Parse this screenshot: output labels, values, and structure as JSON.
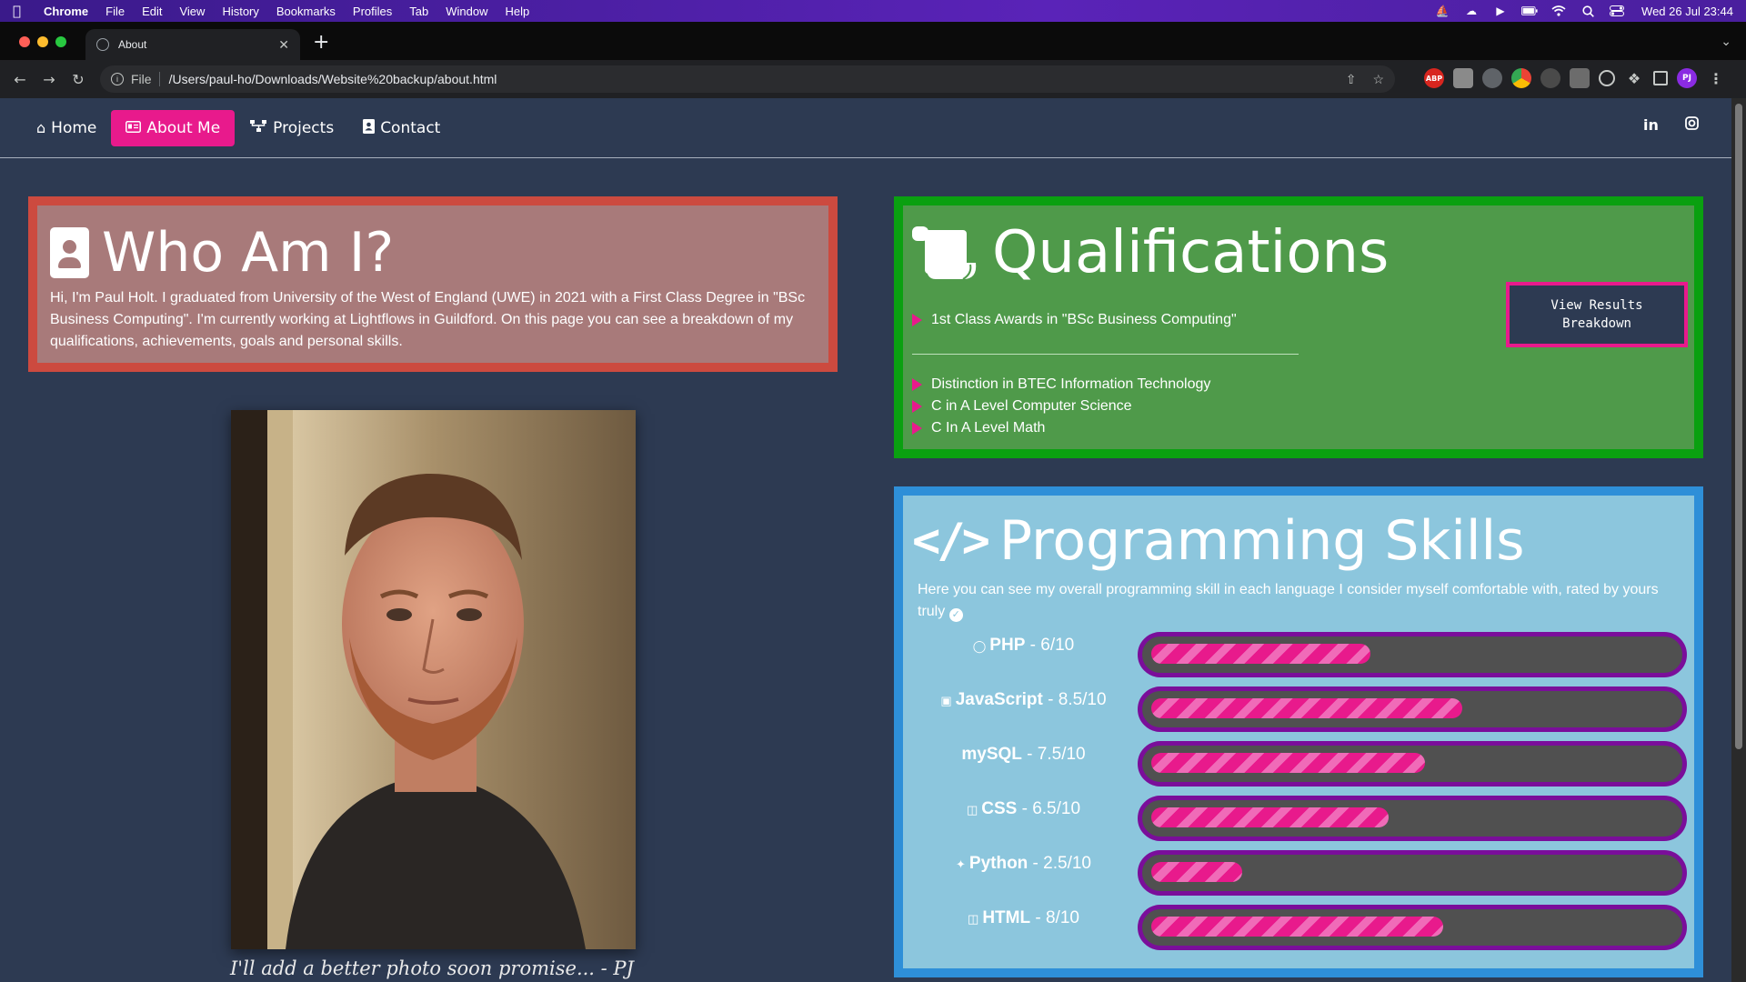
{
  "menubar": {
    "app": "Chrome",
    "items": [
      "File",
      "Edit",
      "View",
      "History",
      "Bookmarks",
      "Profiles",
      "Tab",
      "Window",
      "Help"
    ],
    "clock": "Wed 26 Jul  23:44"
  },
  "browser": {
    "tab_title": "About",
    "url_scheme": "File",
    "url": "/Users/paul-ho/Downloads/Website%20backup/about.html",
    "profile_initials": "PJ",
    "abp_label": "ABP"
  },
  "nav": {
    "items": [
      {
        "label": "Home",
        "icon": "home-icon"
      },
      {
        "label": "About Me",
        "icon": "id-card-icon"
      },
      {
        "label": "Projects",
        "icon": "sitemap-icon"
      },
      {
        "label": "Contact",
        "icon": "contact-card-icon"
      }
    ],
    "active": "About Me",
    "social": {
      "linkedin": "in",
      "instagram": "instagram-icon"
    }
  },
  "who": {
    "title": "Who Am I?",
    "text": "Hi, I'm Paul Holt. I graduated from University of the West of England (UWE) in 2021 with a First Class Degree in \"BSc Business Computing\". I'm currently working at Lightflows in Guildford. On this page you can see a breakdown of my qualifications, achievements, goals and personal skills."
  },
  "photo": {
    "caption": "I'll add a better photo soon promise... - PJ"
  },
  "qualifications": {
    "title": "Qualifications",
    "primary": [
      "1st Class Awards in \"BSc Business Computing\""
    ],
    "secondary": [
      "Distinction in BTEC Information Technology",
      "C in A Level Computer Science",
      "C In A Level Math"
    ],
    "button": "View Results Breakdown"
  },
  "programming": {
    "title": "Programming Skills",
    "intro": "Here you can see my overall programming skill in each language I consider myself comfortable with, rated by yours truly",
    "skills": [
      {
        "name": "PHP",
        "rating": " - 6/10",
        "value": 6,
        "icon": "php-icon"
      },
      {
        "name": "JavaScript",
        "rating": " - 8.5/10",
        "value": 8.5,
        "icon": "js-icon"
      },
      {
        "name": "mySQL",
        "rating": " - 7.5/10",
        "value": 7.5,
        "icon": ""
      },
      {
        "name": "CSS",
        "rating": " - 6.5/10",
        "value": 6.5,
        "icon": "css3-icon"
      },
      {
        "name": "Python",
        "rating": " - 2.5/10",
        "value": 2.5,
        "icon": "python-icon"
      },
      {
        "name": "HTML",
        "rating": " - 8/10",
        "value": 8,
        "icon": "html5-icon"
      }
    ],
    "max": 10
  },
  "colors": {
    "page_bg": "#2d3a52",
    "accent_pink": "#e81a8c",
    "who_border": "#cc4a3f",
    "who_bg": "#a87a7a",
    "qual_border": "#0aa010",
    "qual_bg": "#4f9a4a",
    "prog_border": "#2e8fd8",
    "prog_bg": "#8cc6dd",
    "bar_border": "#7a0e9a"
  }
}
